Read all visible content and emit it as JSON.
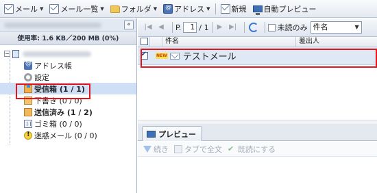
{
  "toolbar": {
    "mail": "メール",
    "mail_list": "メール一覧",
    "folder": "フォルダ",
    "address": "アドレス",
    "new": "新規",
    "auto_preview": "自動プレビュー"
  },
  "sidebar": {
    "collapse": "«",
    "usage": "使用率: 1.6 KB／200 MB (0%)",
    "items": [
      {
        "label": "アドレス帳",
        "icon": "address-book-icon"
      },
      {
        "label": "設定",
        "icon": "gear-icon"
      },
      {
        "label": "受信箱 (1 / 1)",
        "icon": "inbox-icon"
      },
      {
        "label": "下書き (0 / 0)",
        "icon": "draft-icon"
      },
      {
        "label": "送信済み (1 / 2)",
        "icon": "sent-icon"
      },
      {
        "label": "ゴミ箱 (0 / 0)",
        "icon": "trash-icon"
      },
      {
        "label": "迷惑メール (0 / 0)",
        "icon": "spam-icon"
      }
    ]
  },
  "pager": {
    "page_label": "P.",
    "page_value": "1",
    "page_total": "/ 1",
    "unread_only": "未読のみ",
    "sort_select": "件名"
  },
  "grid": {
    "col_subject": "件名",
    "col_sender": "差出人",
    "rows": [
      {
        "badge": "NEW",
        "subject": "テストメール",
        "checked": true
      }
    ]
  },
  "preview": {
    "tab": "プレビュー",
    "continue": "続き",
    "full_text_tab": "タブで全文",
    "mark_read": "既読にする"
  }
}
